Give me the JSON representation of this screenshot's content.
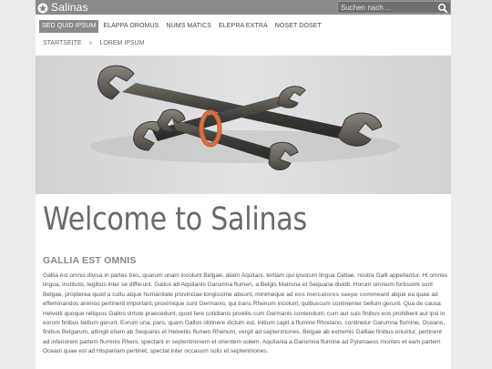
{
  "header": {
    "site_title": "Salinas",
    "logo_icon": "star-badge-icon",
    "search": {
      "placeholder": "Suchen nach ...",
      "value": "",
      "icon": "search-icon"
    }
  },
  "nav": {
    "items": [
      {
        "label": "SED QUID IPSUM",
        "active": true
      },
      {
        "label": "ELAPPA OROMUS",
        "active": false
      },
      {
        "label": "NUMS MATICS",
        "active": false
      },
      {
        "label": "ELEPRA EXTRA",
        "active": false
      },
      {
        "label": "NOSET DOSET",
        "active": false
      }
    ]
  },
  "breadcrumb": {
    "items": [
      "STARTSEITE",
      "LOREM IPSUM"
    ],
    "separator": "»"
  },
  "hero": {
    "image_alt": "wrenches tied with a rubber band"
  },
  "main": {
    "title": "Welcome to Salinas",
    "subheading": "GALLIA EST OMNIS",
    "paragraph_before_link": "Gallia est omnis divisa in partes tres, quarum unam incolunt Belgae, aliam Aquitani, tertiam qui ipsorum lingua Celtae, nostra Galli appellantur. Hi omnes lingua, institutis, legibus inter se differunt. Gallos ab Aquitanis Garumna flumen, a Belgis Matrona et Sequana dividit. Horum omnium fortissimi sunt Belgae, propterea quod a cultu atque humanitate provinciae longissime absunt, minimeque ad ",
    "paragraph_link": "eos mercatores saepe commeant",
    "paragraph_after_link": " atque ea quae ad effeminandos animos pertinent important, proximique sunt Germanis, qui trans Rhenum incolunt, quibuscum continenter bellum gerunt. Qua de causa Helvetii quoque reliquos Gallos virtute praecedunt, quod fere cotidianis proeliis cum Germanis contendunt, cum aut suis finibus eos prohibent aut ipsi in eorum finibus bellum gerunt. Eorum una, pars, quam Gallos obtinere dictum est, initium capit a flumine Rhodano, continetur Garumna flumine, Oceano, finibus Belgarum, attingit etiam ab Sequanis et Helvetiis flumen Rhenum, vergit ad septentriones. Belgae ab extremis Galliae finibus oriuntur, pertinent ad inferiorem partem fluminis Rheni, spectant in septentrionem et orientem solem. Aquitania a Garumna flumine ad Pyrenaeos montes et eam partem Oceani quae est ad Hispaniam pertinet; spectat inter occasum solis et septentriones."
  },
  "colors": {
    "page_bg": "#ebebeb",
    "header_bg": "#8a8a8a",
    "nav_active_bg": "#8a8a8a",
    "title_text": "#6a6a6a",
    "body_text": "#555555"
  }
}
